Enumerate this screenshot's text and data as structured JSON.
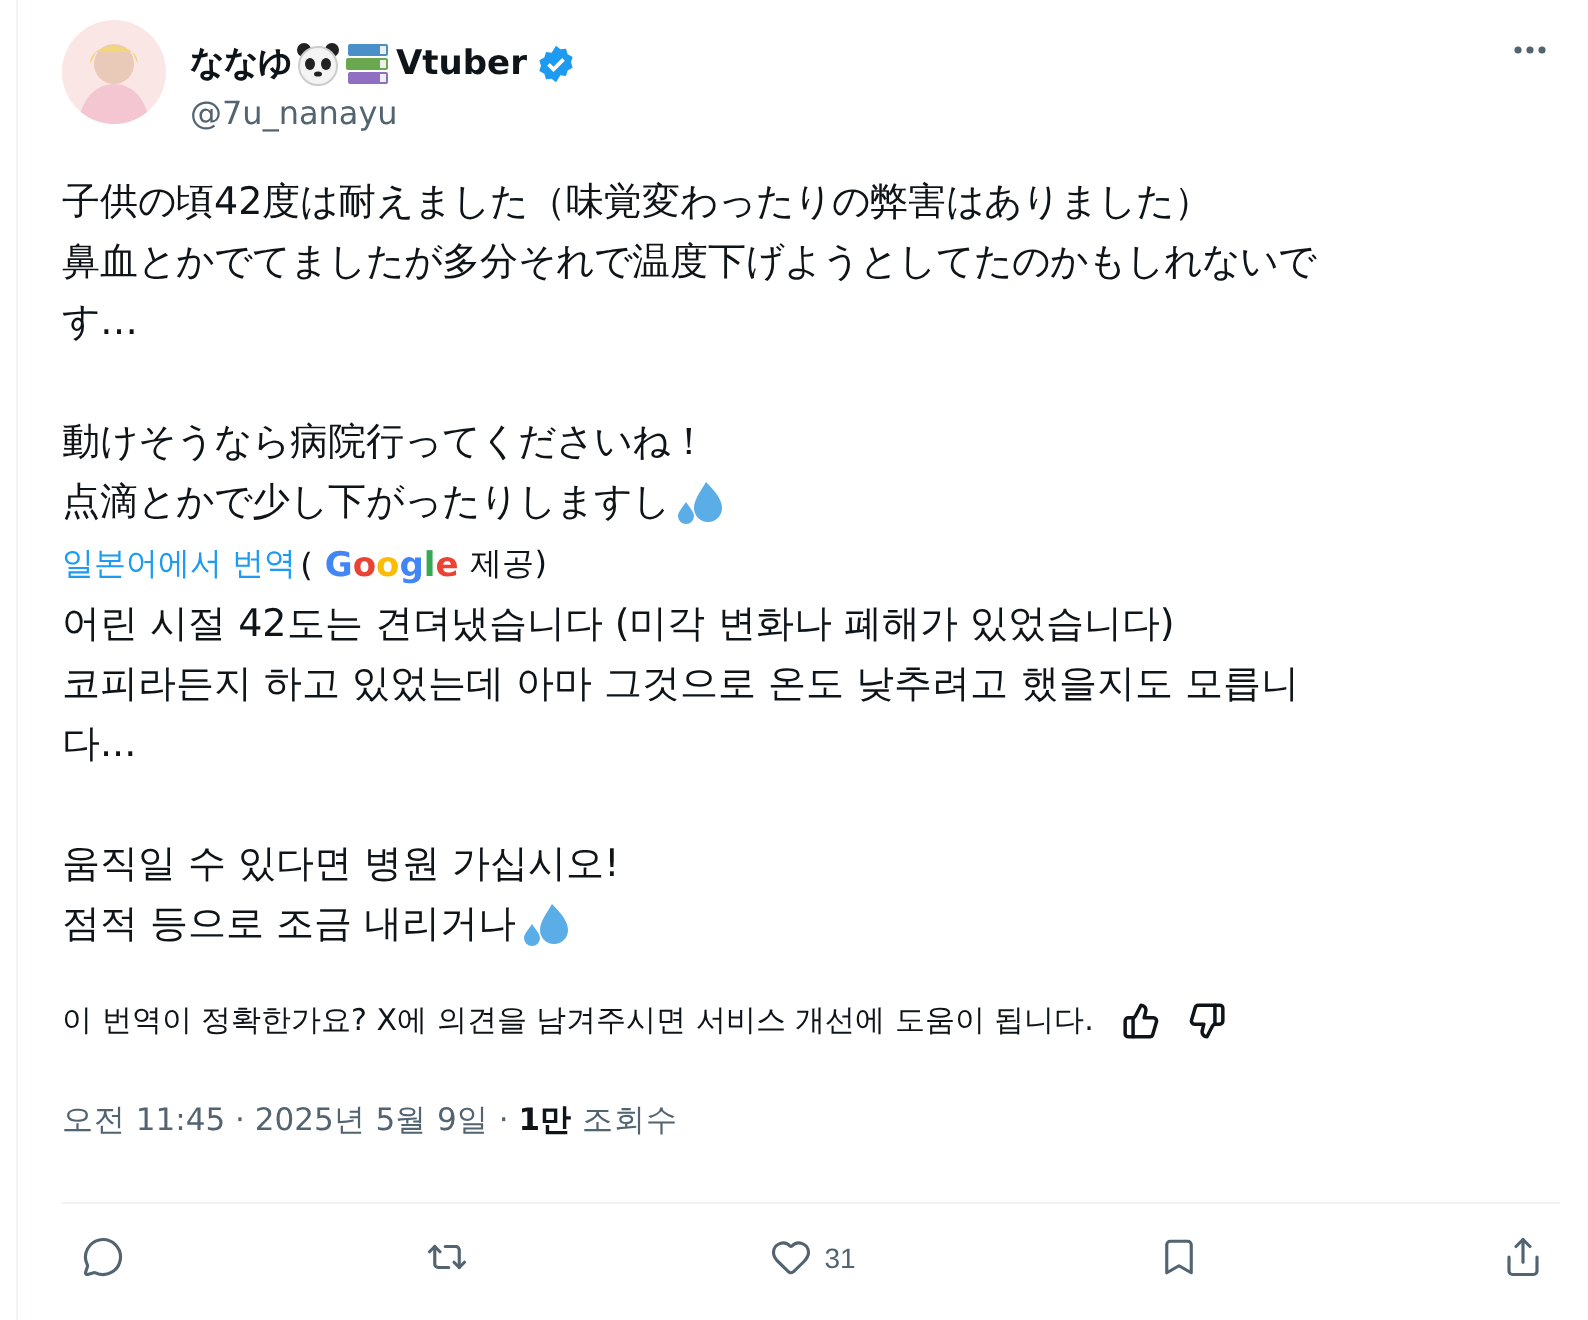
{
  "author": {
    "name": "ななゆ",
    "name_suffix": "Vtuber",
    "verified": true,
    "handle": "@7u_nanayu"
  },
  "original_lines": [
    {
      "kind": "text",
      "text": "子供の頃42度は耐えました（味覚変わったりの弊害はありました）"
    },
    {
      "kind": "text",
      "text": "鼻血とかでてましたが多分それで温度下げようとしてたのかもしれないで"
    },
    {
      "kind": "text",
      "text": "す…"
    },
    {
      "kind": "blank"
    },
    {
      "kind": "text",
      "text": "動けそうなら病院行ってくださいね！"
    },
    {
      "kind": "text_with_droplets",
      "text": "点滴とかで少し下がったりしますし"
    }
  ],
  "translation_credit": {
    "link": "일본어에서 번역",
    "open": "(",
    "provider": "Google",
    "close": "제공)"
  },
  "translated_lines": [
    {
      "kind": "text",
      "text": "어린 시절 42도는 견뎌냈습니다 (미각 변화나 폐해가 있었습니다)"
    },
    {
      "kind": "text",
      "text": "코피라든지 하고 있었는데 아마 그것으로 온도 낮추려고 했을지도 모릅니"
    },
    {
      "kind": "text",
      "text": "다..."
    },
    {
      "kind": "blank"
    },
    {
      "kind": "text",
      "text": "움직일 수 있다면 병원 가십시오!"
    },
    {
      "kind": "text_with_droplets",
      "text": "점적 등으로 조금 내리거나"
    }
  ],
  "feedback": {
    "question": "이 번역이 정확한가요? X에 의견을 남겨주시면 서비스 개선에 도움이 됩니다."
  },
  "meta": "오전 11:45 · 2025년 5월 9일 · **1만** 조회수",
  "actions": [
    {
      "kind": "reply"
    },
    {
      "kind": "repost"
    },
    {
      "kind": "like",
      "count": "31"
    },
    {
      "kind": "bookmark"
    },
    {
      "kind": "share"
    }
  ]
}
